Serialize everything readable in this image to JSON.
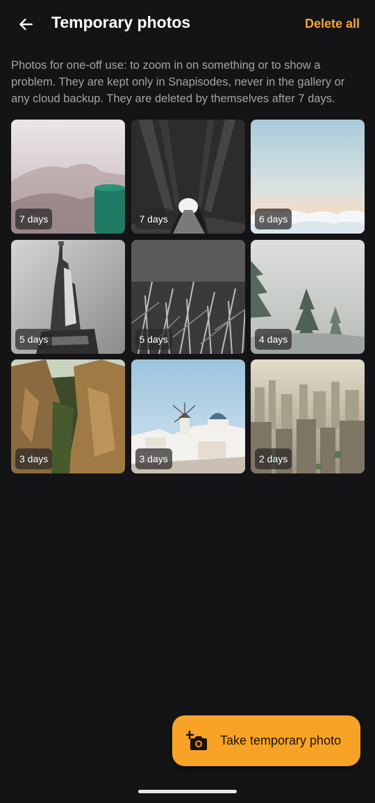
{
  "header": {
    "title": "Temporary photos",
    "delete_all_label": "Delete all",
    "back_icon": "arrow-left-icon"
  },
  "description": "Photos for one-off use: to zoom in on something or to show a problem. They are kept only in Snapisodes, never in the gallery or any cloud backup. They are deleted by themselves after 7 days.",
  "photos": [
    {
      "label": "7 days",
      "subject": "mug-with-blurred-background"
    },
    {
      "label": "7 days",
      "subject": "tree-tunnel-black-and-white"
    },
    {
      "label": "6 days",
      "subject": "sea-of-clouds"
    },
    {
      "label": "5 days",
      "subject": "statue-of-liberty"
    },
    {
      "label": "5 days",
      "subject": "grass-closeup"
    },
    {
      "label": "4 days",
      "subject": "foggy-pine-forest"
    },
    {
      "label": "3 days",
      "subject": "sandstone-cliffs"
    },
    {
      "label": "3 days",
      "subject": "white-village-with-windmill"
    },
    {
      "label": "2 days",
      "subject": "hazy-city-skyline"
    }
  ],
  "fab": {
    "label": "Take temporary photo",
    "icon": "add-camera-icon",
    "color": "#f8a326"
  },
  "colors": {
    "background": "#141416",
    "accent": "#f5a432",
    "description_text": "#a4a4a8"
  }
}
